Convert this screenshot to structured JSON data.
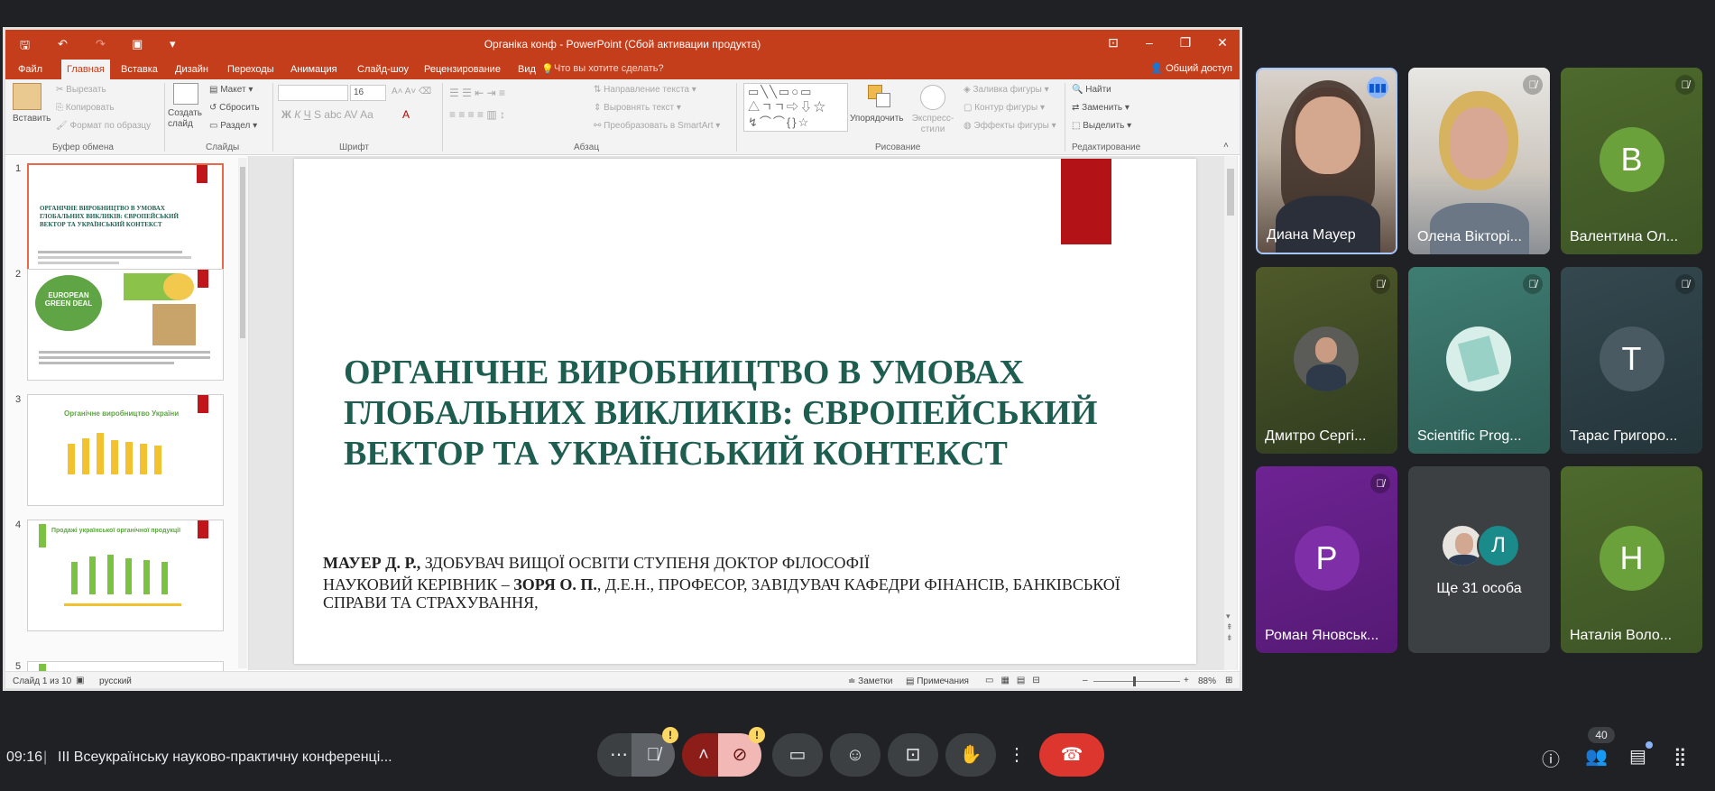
{
  "ppt": {
    "window_title": "Органіка конф - PowerPoint (Сбой активации продукта)",
    "tabs": [
      "Файл",
      "Главная",
      "Вставка",
      "Дизайн",
      "Переходы",
      "Анимация",
      "Слайд-шоу",
      "Рецензирование",
      "Вид"
    ],
    "active_tab": "Главная",
    "search_hint": "Что вы хотите сделать?",
    "share": "Общий доступ",
    "ribbon": {
      "paste": "Вставить",
      "cut": "Вырезать",
      "copy": "Копировать",
      "format_painter": "Формат по образцу",
      "clipboard_group": "Буфер обмена",
      "new_slide": "Создать слайд",
      "layout": "Макет",
      "reset": "Сбросить",
      "section": "Раздел",
      "slides_group": "Слайды",
      "font_size": "16",
      "font_group": "Шрифт",
      "text_direction": "Направление текста",
      "align_text": "Выровнять текст",
      "smartart": "Преобразовать в SmartArt",
      "paragraph_group": "Абзац",
      "arrange": "Упорядочить",
      "quick_styles": "Экспресс-стили",
      "shape_fill": "Заливка фигуры",
      "shape_outline": "Контур фигуры",
      "shape_effects": "Эффекты фигуры",
      "drawing_group": "Рисование",
      "find": "Найти",
      "replace": "Заменить",
      "select": "Выделить",
      "editing_group": "Редактирование"
    },
    "thumbnails": [
      {
        "num": "1",
        "title": "ОРГАНІЧНЕ ВИРОБНИЦТВО В УМОВАХ ГЛОБАЛЬНИХ ВИКЛИКІВ: ЄВРОПЕЙСЬКИЙ ВЕКТОР ТА УКРАЇНСЬКИЙ КОНТЕКСТ"
      },
      {
        "num": "2",
        "title": "EUROPEAN GREEN DEAL"
      },
      {
        "num": "3",
        "title": "Органічне виробництво України"
      },
      {
        "num": "4",
        "title": "Продажі української органічної продукції"
      },
      {
        "num": "5",
        "title": ""
      }
    ],
    "slide": {
      "title": "ОРГАНІЧНЕ ВИРОБНИЦТВО В УМОВАХ ГЛОБАЛЬНИХ ВИКЛИКІВ: ЄВРОПЕЙСЬКИЙ ВЕКТОР ТА УКРАЇНСЬКИЙ КОНТЕКСТ",
      "author_name": "МАУЕР Д. Р.,",
      "author_rest": " ЗДОБУВАЧ ВИЩОЇ ОСВІТИ СТУПЕНЯ ДОКТОР ФІЛОСОФІЇ",
      "supervisor_prefix": "НАУКОВИЙ КЕРІВНИК – ",
      "supervisor_name": "ЗОРЯ О. П.",
      "supervisor_rest": ", Д.Е.Н., ПРОФЕСОР, ЗАВІДУВАЧ КАФЕДРИ ФІНАНСІВ, БАНКІВСЬКОЇ СПРАВИ ТА СТРАХУВАННЯ,"
    },
    "status": {
      "slide_of": "Слайд 1 из 10",
      "language": "русский",
      "notes": "Заметки",
      "comments": "Примечания",
      "zoom": "88%"
    }
  },
  "participants": [
    {
      "name": "Диана Мауер",
      "type": "video",
      "speaking": true
    },
    {
      "name": "Олена Вікторі...",
      "type": "video",
      "muted": true
    },
    {
      "name": "Валентина Ол...",
      "initial": "В",
      "color": "#6aa13a",
      "muted": true
    },
    {
      "name": "Дмитро Сергі...",
      "type": "photo",
      "muted": true
    },
    {
      "name": "Scientific Prog...",
      "type": "photo",
      "muted": true
    },
    {
      "name": "Тарас Григоро...",
      "initial": "Т",
      "color": "#4a5a62",
      "muted": true
    },
    {
      "name": "Роман Яновськ...",
      "initial": "Р",
      "color": "#7e2ea6",
      "muted": true
    },
    {
      "name": "Ще 31 особа",
      "initial": "Л",
      "color": "#1a8a8a"
    },
    {
      "name": "Наталія Воло...",
      "initial": "Н",
      "color": "#6aa13a"
    }
  ],
  "meet": {
    "time": "09:16",
    "meeting_title": "ІІІ Всеукраїнську науково-практичну конференці...",
    "people_count": "40"
  }
}
